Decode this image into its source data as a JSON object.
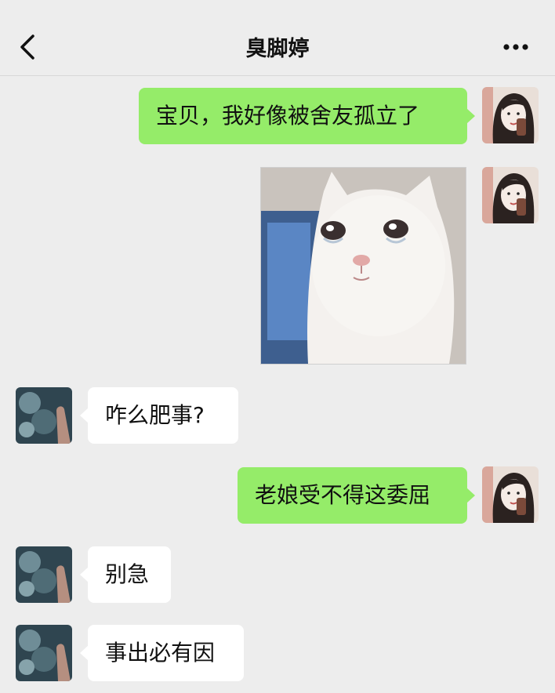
{
  "header": {
    "title": "臭脚婷",
    "back_icon": "chevron-left-icon",
    "more_icon": "more-dots-icon"
  },
  "messages": [
    {
      "from": "me",
      "type": "text",
      "text": "宝贝，我好像被舍友孤立了"
    },
    {
      "from": "me",
      "type": "image",
      "image": "crying-cat-meme"
    },
    {
      "from": "other",
      "type": "text",
      "text": "咋么肥事?"
    },
    {
      "from": "me",
      "type": "text",
      "text": "老娘受不得这委屈"
    },
    {
      "from": "other",
      "type": "text",
      "text": "别急"
    },
    {
      "from": "other",
      "type": "text",
      "text": "事出必有因"
    }
  ],
  "colors": {
    "background": "#ededed",
    "my_bubble": "#95ec69",
    "other_bubble": "#ffffff"
  }
}
